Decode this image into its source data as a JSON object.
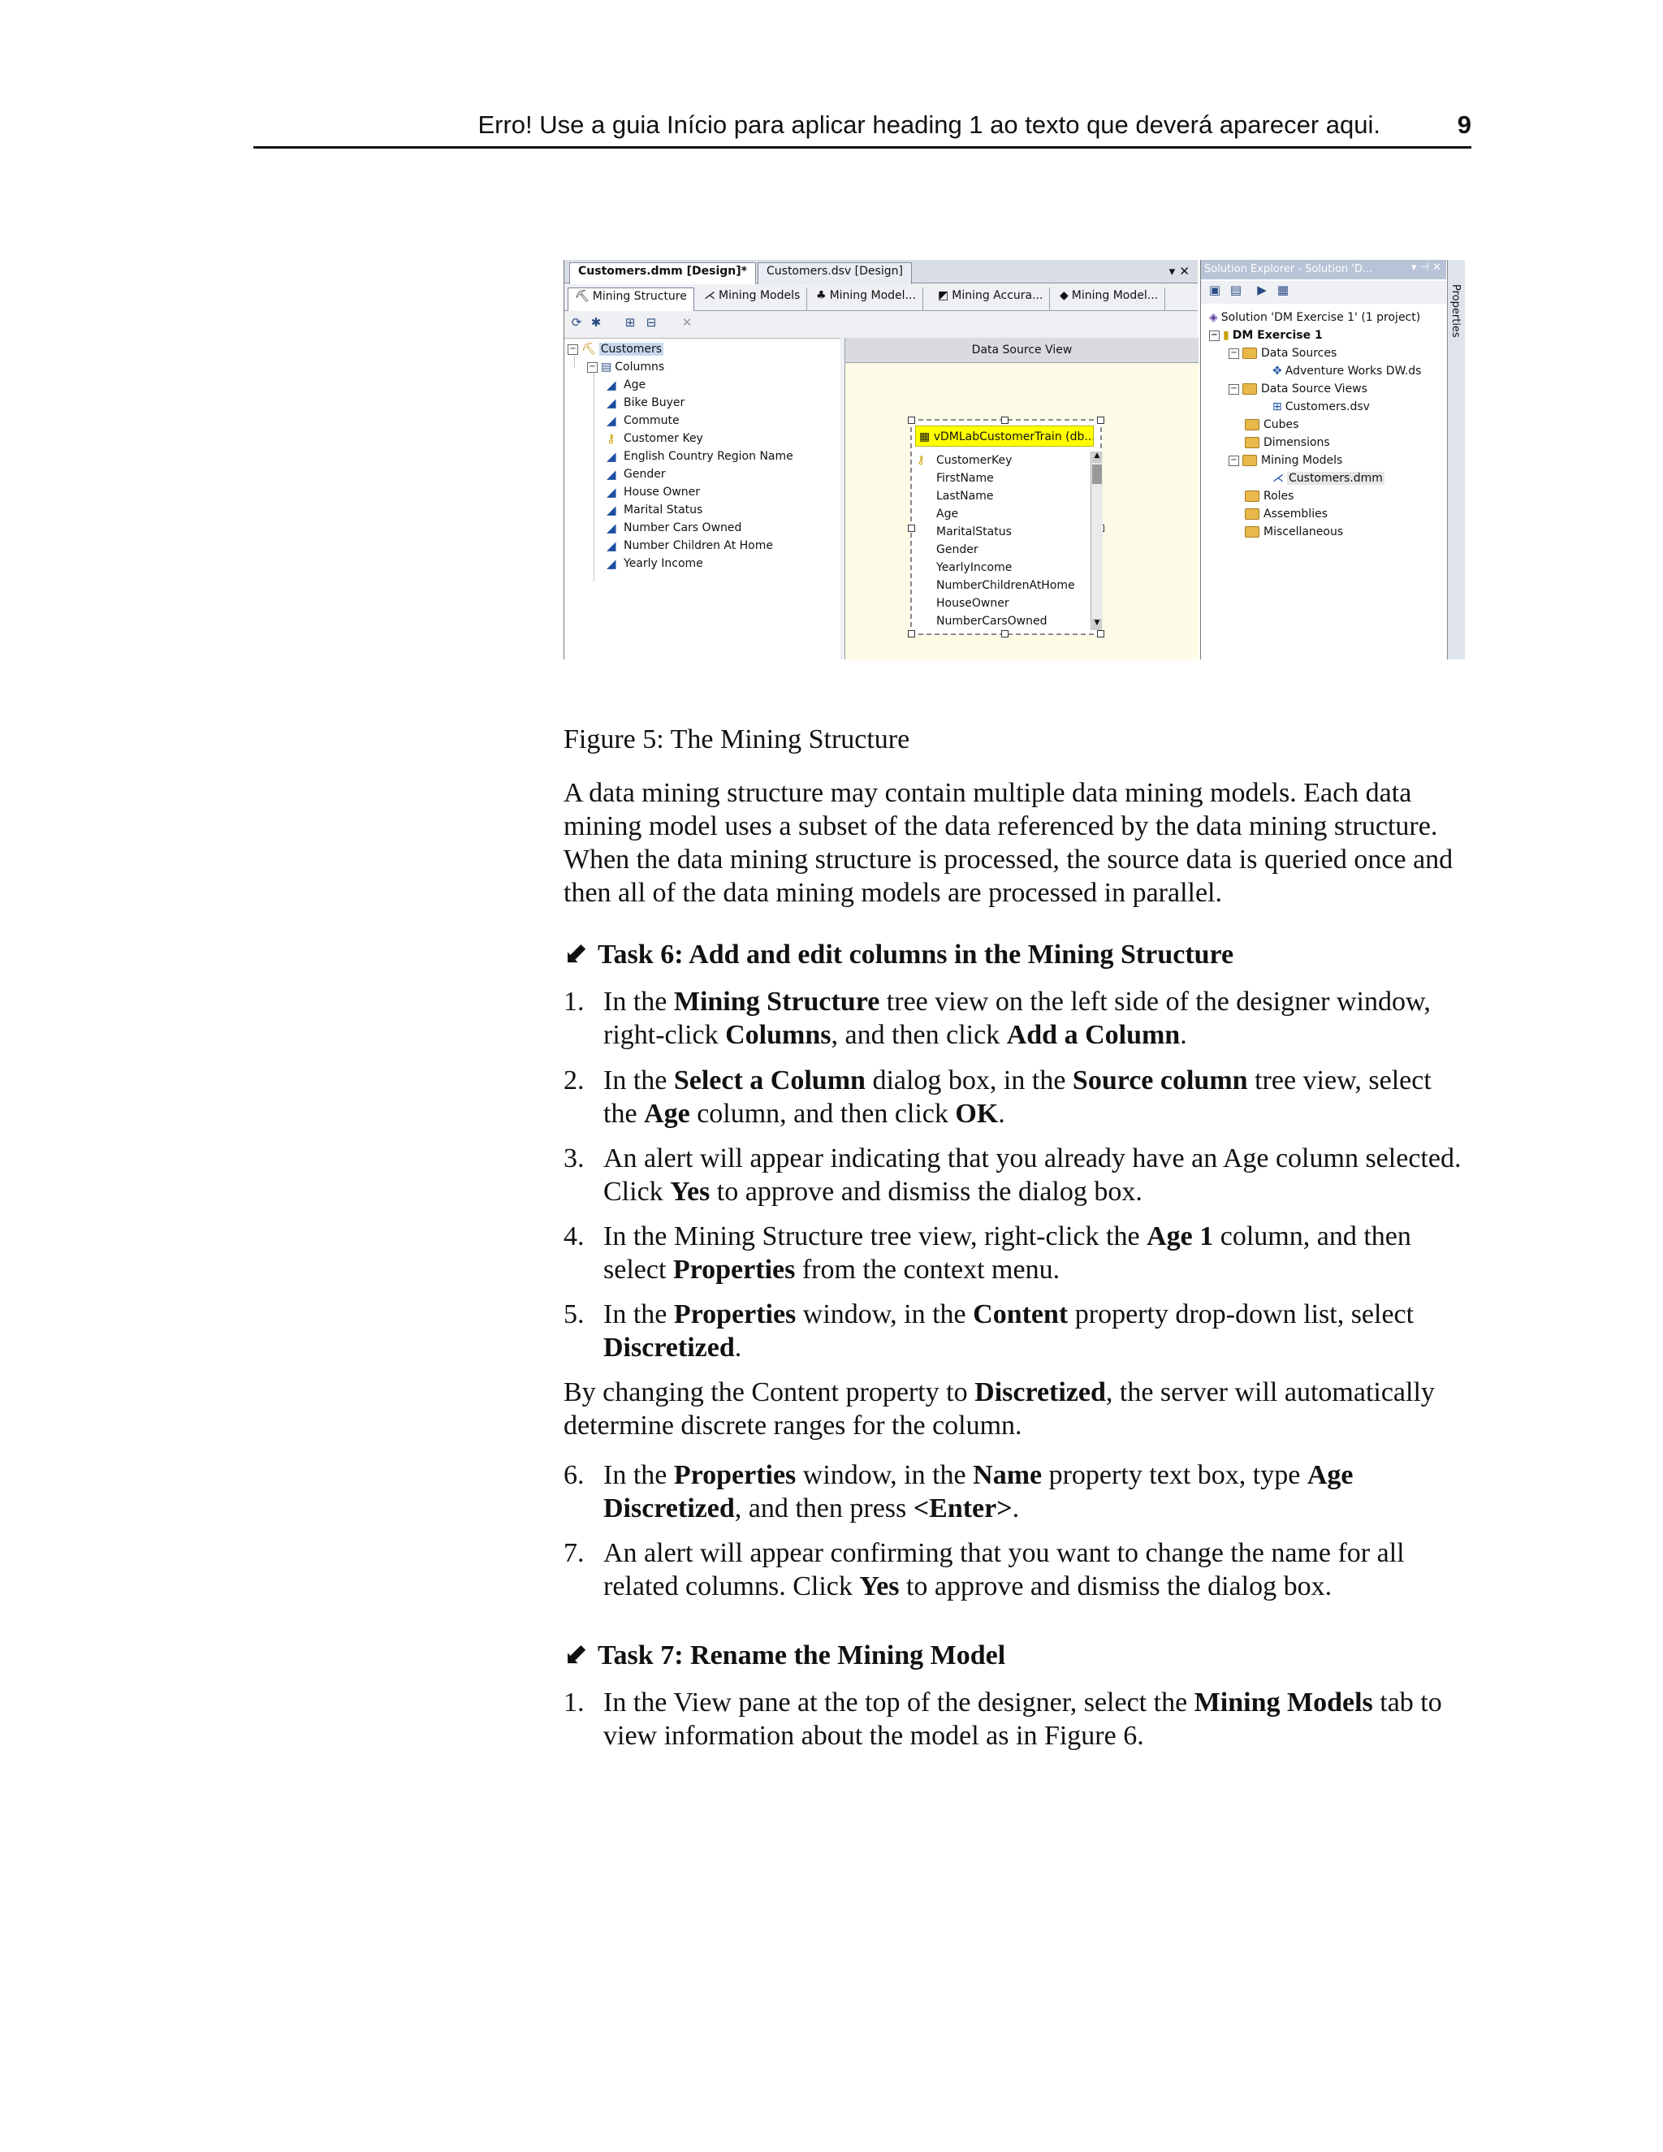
{
  "header": {
    "title": "Erro! Use a guia Início para aplicar heading 1 ao texto que deverá aparecer aqui.",
    "page_number": "9"
  },
  "screenshot": {
    "doc_tabs": [
      "Customers.dmm [Design]*",
      "Customers.dsv [Design]"
    ],
    "window_buttons": "▾ ✕",
    "view_tabs": [
      "Mining Structure",
      "Mining Models",
      "Mining Model...",
      "Mining Accura...",
      "Mining Model..."
    ],
    "tree": {
      "root": "Customers",
      "group": "Columns",
      "columns": [
        "Age",
        "Bike Buyer",
        "Commute",
        "Customer Key",
        "English Country Region Name",
        "Gender",
        "House Owner",
        "Marital Status",
        "Number Cars Owned",
        "Number Children At Home",
        "Yearly Income"
      ]
    },
    "dsv": {
      "title": "Data Source View",
      "table_name": "vDMLabCustomerTrain (db...",
      "table_columns": [
        "CustomerKey",
        "FirstName",
        "LastName",
        "Age",
        "MaritalStatus",
        "Gender",
        "YearlyIncome",
        "NumberChildrenAtHome",
        "HouseOwner",
        "NumberCarsOwned"
      ]
    },
    "solution_explorer": {
      "title": "Solution Explorer - Solution 'D...",
      "solution": "Solution 'DM Exercise 1' (1 project)",
      "project": "DM Exercise 1",
      "items": [
        {
          "label": "Data Sources",
          "level": 1
        },
        {
          "label": "Adventure Works DW.ds",
          "level": 2
        },
        {
          "label": "Data Source Views",
          "level": 1
        },
        {
          "label": "Customers.dsv",
          "level": 2
        },
        {
          "label": "Cubes",
          "level": 1
        },
        {
          "label": "Dimensions",
          "level": 1
        },
        {
          "label": "Mining Models",
          "level": 1
        },
        {
          "label": "Customers.dmm",
          "level": 2
        },
        {
          "label": "Roles",
          "level": 1
        },
        {
          "label": "Assemblies",
          "level": 1
        },
        {
          "label": "Miscellaneous",
          "level": 1
        }
      ],
      "properties_tab": "Properties"
    }
  },
  "figure_caption": "Figure 5: The Mining Structure",
  "intro_paragraph": "A data mining structure may contain multiple data mining models. Each data mining model uses a subset of the data referenced by the data mining structure. When the data mining structure is processed, the source data is queried once and then all of the data mining models are processed in parallel.",
  "task6": {
    "title": "Task 6: Add and edit columns in the Mining Structure",
    "steps": [
      {
        "n": "1.",
        "parts": [
          "In the ",
          "Mining Structure",
          " tree view on the left side of the designer window, right-click ",
          "Columns",
          ", and then click ",
          "Add a Column",
          "."
        ]
      },
      {
        "n": "2.",
        "parts": [
          "In the ",
          "Select a Column",
          " dialog box, in the ",
          "Source column",
          " tree view, select the ",
          "Age",
          " column, and then click ",
          "OK",
          "."
        ]
      },
      {
        "n": "3.",
        "parts": [
          "An alert will appear indicating that you already have an Age column selected. Click ",
          "Yes",
          " to approve and dismiss the dialog box."
        ]
      },
      {
        "n": "4.",
        "parts": [
          "In the Mining Structure tree view, right-click the ",
          "Age 1",
          " column, and then select ",
          "Properties",
          " from the context menu."
        ]
      },
      {
        "n": "5.",
        "parts": [
          "In the ",
          "Properties",
          " window, in the ",
          "Content",
          " property drop-down list, select ",
          "Discretized",
          "."
        ]
      }
    ],
    "middle_paragraph": [
      "By changing the Content property to ",
      "Discretized",
      ", the server will automatically determine discrete ranges for the column."
    ],
    "steps_b": [
      {
        "n": "6.",
        "parts": [
          "In the ",
          "Properties",
          " window, in the ",
          "Name",
          " property text box, type ",
          "Age Discretized",
          ", and then press ",
          "<Enter>",
          "."
        ]
      },
      {
        "n": "7.",
        "parts": [
          "An alert will appear confirming that you want to change the name for all related columns. Click ",
          "Yes",
          " to approve and dismiss the dialog box."
        ]
      }
    ]
  },
  "task7": {
    "title": "Task 7: Rename the Mining Model",
    "steps": [
      {
        "n": "1.",
        "parts": [
          "In the View pane at the top of the designer, select the ",
          "Mining Models",
          "  tab to view information about the model as in Figure 6."
        ]
      }
    ]
  },
  "icons": {
    "task_marker": "task-arrow-icon",
    "column": "mining-column-icon",
    "key": "key-icon",
    "folder": "folder-icon"
  }
}
